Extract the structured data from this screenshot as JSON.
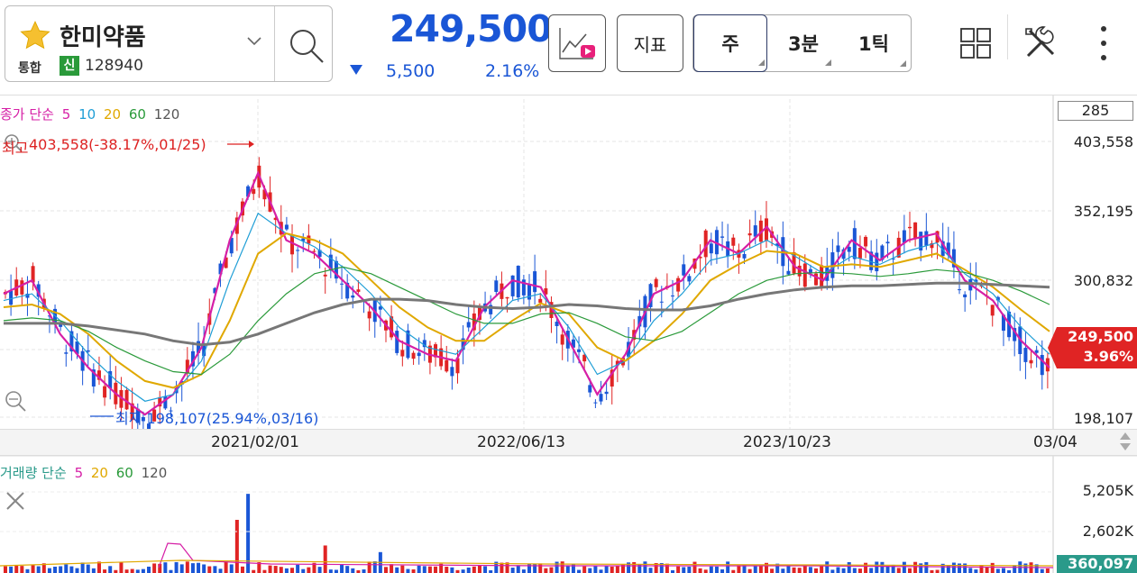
{
  "stock": {
    "name": "한미약품",
    "market": "통합",
    "badge": "신",
    "code": "128940",
    "price": "249,500",
    "change": "5,500",
    "rate": "2.16%"
  },
  "toolbar": {
    "indicator_label": "지표",
    "periods": [
      "주",
      "3분",
      "1틱"
    ],
    "active_period": "주"
  },
  "chart": {
    "ma_legend": {
      "prefix": "종가 단순",
      "items": [
        {
          "label": "5",
          "color": "#d61fa6"
        },
        {
          "label": "10",
          "color": "#1f9ed6"
        },
        {
          "label": "20",
          "color": "#e0a800"
        },
        {
          "label": "60",
          "color": "#2a9a3a"
        },
        {
          "label": "120",
          "color": "#555555"
        }
      ],
      "prefix_color": "#d61fa6"
    },
    "high_prefix": "최고",
    "high_label": "403,558(-38.17%,01/25)",
    "low_label": "최저 198,107(25.94%,03/16)",
    "y_top_box": "285",
    "y_labels": [
      "403,558",
      "352,195",
      "300,832",
      "198,107"
    ],
    "current_price": "249,500",
    "current_rate": "3.96%",
    "x_labels": [
      "2021/02/01",
      "2022/06/13",
      "2023/10/23",
      "03/04"
    ],
    "volume_legend": {
      "prefix": "거래량 단순",
      "items": [
        {
          "label": "5",
          "color": "#d61fa6"
        },
        {
          "label": "20",
          "color": "#e0a800"
        },
        {
          "label": "60",
          "color": "#2a9a3a"
        },
        {
          "label": "120",
          "color": "#555555"
        }
      ],
      "prefix_color": "#2a9a8a"
    },
    "volume_y_labels": [
      "5,205K",
      "2,602K"
    ],
    "current_volume": "360,097"
  },
  "colors": {
    "up": "#e02424",
    "down": "#1a56d6",
    "accent": "#1a56d6"
  },
  "chart_data": {
    "type": "line",
    "title": "",
    "y_range": [
      198107,
      403558
    ],
    "x_ticks": [
      "2021/02/01",
      "2022/06/13",
      "2023/10/23",
      "03/04"
    ],
    "series": [
      {
        "values": [
          290000,
          300000,
          260000,
          235000,
          215000,
          200000,
          215000,
          250000,
          330000,
          380000,
          330000,
          320000,
          300000,
          280000,
          255000,
          245000,
          240000,
          280000,
          300000,
          295000,
          255000,
          215000,
          245000,
          290000,
          300000,
          330000,
          320000,
          340000,
          310000,
          300000,
          330000,
          315000,
          330000,
          335000,
          300000,
          285000,
          255000,
          235000
        ]
      },
      {
        "values": [
          285000,
          290000,
          270000,
          245000,
          225000,
          210000,
          215000,
          240000,
          300000,
          350000,
          335000,
          325000,
          310000,
          290000,
          265000,
          250000,
          245000,
          265000,
          285000,
          290000,
          265000,
          230000,
          240000,
          270000,
          290000,
          315000,
          320000,
          330000,
          318000,
          305000,
          318000,
          312000,
          322000,
          328000,
          305000,
          290000,
          265000,
          245000
        ]
      },
      {
        "values": [
          280000,
          282000,
          275000,
          260000,
          240000,
          225000,
          220000,
          230000,
          270000,
          320000,
          335000,
          330000,
          320000,
          300000,
          280000,
          265000,
          255000,
          255000,
          270000,
          283000,
          275000,
          250000,
          240000,
          255000,
          275000,
          300000,
          312000,
          322000,
          320000,
          310000,
          312000,
          310000,
          315000,
          320000,
          308000,
          295000,
          278000,
          262000
        ]
      },
      {
        "values": [
          270000,
          272000,
          270000,
          262000,
          250000,
          240000,
          232000,
          230000,
          245000,
          270000,
          290000,
          305000,
          310000,
          305000,
          295000,
          285000,
          275000,
          268000,
          268000,
          275000,
          276000,
          268000,
          258000,
          255000,
          262000,
          276000,
          290000,
          300000,
          305000,
          306000,
          305000,
          303000,
          305000,
          308000,
          306000,
          300000,
          292000,
          282000
        ]
      },
      {
        "values": [
          268000,
          268000,
          268000,
          266000,
          263000,
          260000,
          255000,
          252000,
          254000,
          260000,
          268000,
          276000,
          282000,
          286000,
          286000,
          285000,
          282000,
          280000,
          279000,
          280000,
          282000,
          281000,
          279000,
          278000,
          278000,
          281000,
          286000,
          290000,
          293000,
          295000,
          296000,
          296000,
          297000,
          298000,
          298000,
          297000,
          296000,
          295000
        ]
      }
    ]
  }
}
